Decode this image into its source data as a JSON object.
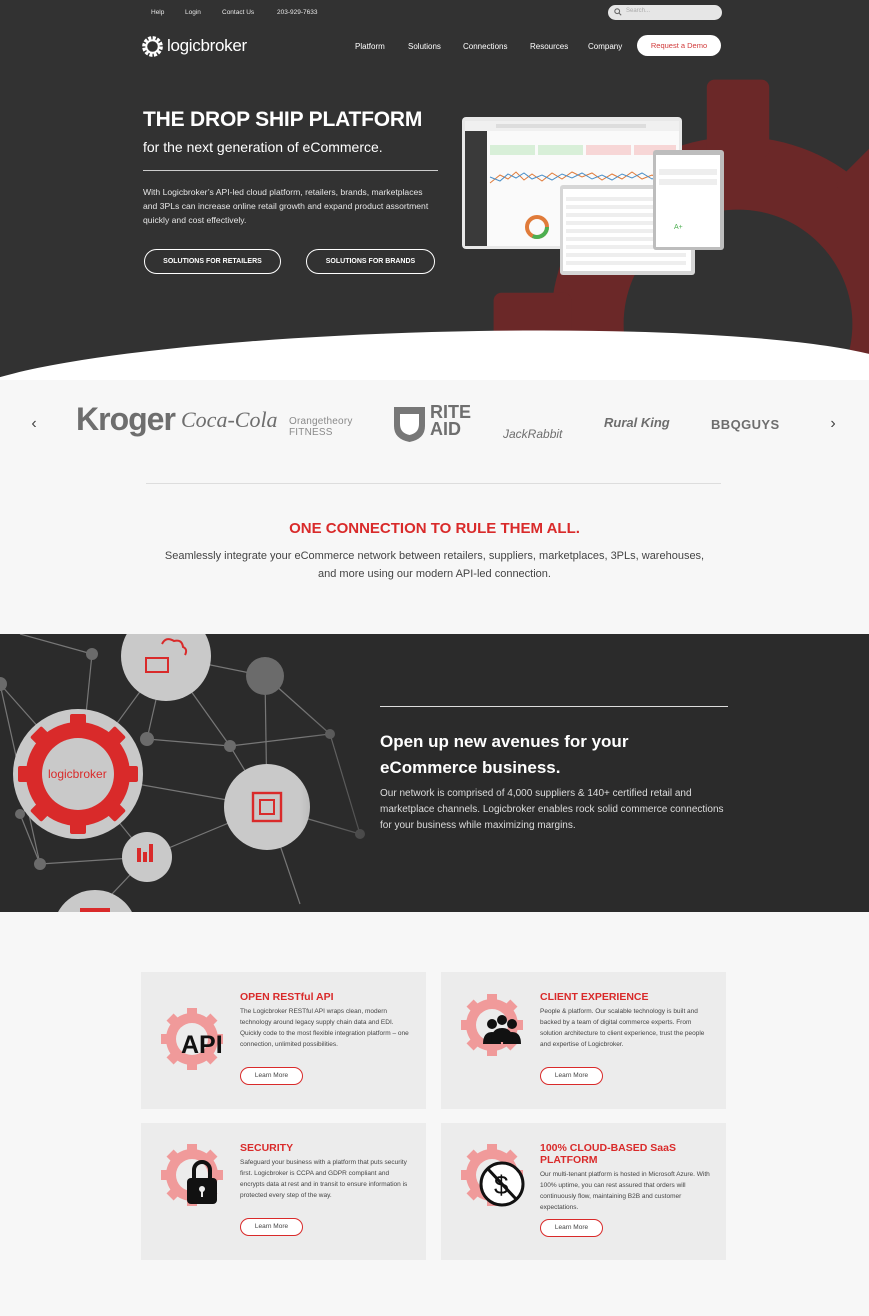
{
  "topbar": {
    "help": "Help",
    "login": "Login",
    "contact": "Contact Us",
    "phone": "203-929-7633",
    "search_placeholder": "Search..."
  },
  "logo": {
    "text": "logicbroker"
  },
  "nav": {
    "items": [
      "Platform",
      "Solutions",
      "Connections",
      "Resources",
      "Company"
    ],
    "demo": "Request a Demo"
  },
  "hero": {
    "title": "THE DROP SHIP PLATFORM",
    "subtitle": "for the next generation of eCommerce.",
    "body": "With Logicbroker’s API-led cloud platform, retailers, brands, marketplaces and 3PLs can increase online retail growth and expand product assortment quickly and cost effectively.",
    "btn_retailers": "SOLUTIONS FOR RETAILERS",
    "btn_brands": "SOLUTIONS FOR BRANDS"
  },
  "brands": {
    "items": [
      "Kroger",
      "Coca-Cola",
      "Orangetheory FITNESS",
      "RITE AID",
      "JackRabbit",
      "Rural King",
      "BBQGUYS"
    ],
    "prev": "‹",
    "next": "›"
  },
  "connection": {
    "title": "ONE CONNECTION TO RULE THEM ALL.",
    "body": "Seamlessly integrate your eCommerce network between retailers, suppliers, marketplaces, 3PLs, warehouses, and more using our modern API-led connection."
  },
  "network": {
    "logo": "logicbroker",
    "title": "Open up new avenues for your eCommerce business.",
    "body": "Our network is comprised of 4,000 suppliers & 140+ certified retail and marketplace channels. Logicbroker enables rock solid commerce connections for your business while maximizing margins."
  },
  "features": [
    {
      "title": "OPEN RESTful API",
      "body": "The Logicbroker RESTful API wraps clean, modern technology around legacy supply chain data and EDI. Quickly code to the most flexible integration platform – one connection, unlimited possibilities.",
      "cta": "Learn More",
      "icon": "API"
    },
    {
      "title": "CLIENT EXPERIENCE",
      "body": "People & platform. Our scalable technology is built and backed by a team of digital commerce experts. From solution architecture to client experience, trust the people and expertise of Logicbroker.",
      "cta": "Learn More"
    },
    {
      "title": "SECURITY",
      "body": "Safeguard your business with a platform that puts security first. Logicbroker is CCPA and GDPR compliant and encrypts data at rest and in transit to ensure information is protected every step of the way.",
      "cta": "Learn More"
    },
    {
      "title": "100% CLOUD-BASED SaaS PLATFORM",
      "body": "Our multi-tenant platform is hosted in Microsoft Azure. With 100% uptime, you can rest assured that orders will continuously flow, maintaining B2B and customer expectations.",
      "cta": "Learn More"
    }
  ],
  "colors": {
    "accent": "#d92a2a",
    "dark": "#323232",
    "gear": "#7a2a2a"
  }
}
